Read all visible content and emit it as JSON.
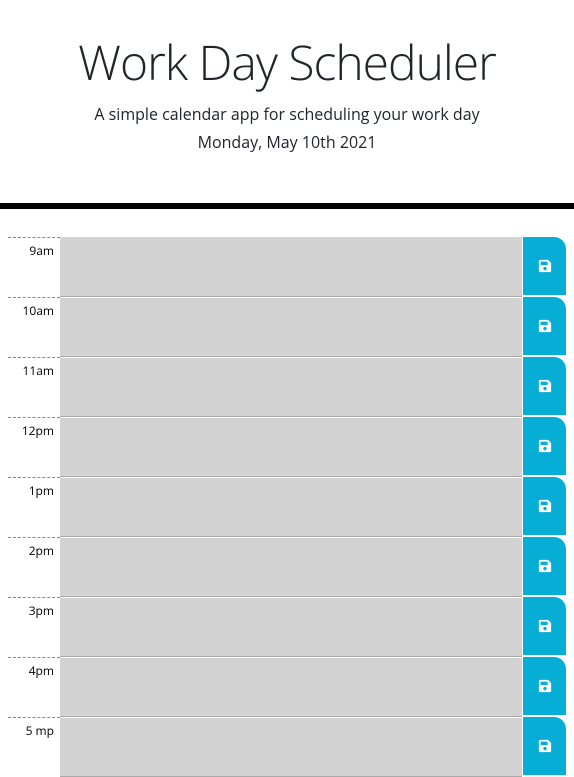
{
  "header": {
    "title": "Work Day Scheduler",
    "subtitle": "A simple calendar app for scheduling your work day",
    "currentDay": "Monday, May 10th 2021"
  },
  "colors": {
    "saveButton": "#06aed5",
    "past": "#d3d3d3"
  },
  "timeBlocks": [
    {
      "hour": "9am",
      "value": ""
    },
    {
      "hour": "10am",
      "value": ""
    },
    {
      "hour": "11am",
      "value": ""
    },
    {
      "hour": "12pm",
      "value": ""
    },
    {
      "hour": "1pm",
      "value": ""
    },
    {
      "hour": "2pm",
      "value": ""
    },
    {
      "hour": "3pm",
      "value": ""
    },
    {
      "hour": "4pm",
      "value": ""
    },
    {
      "hour": "5 mp",
      "value": ""
    }
  ]
}
